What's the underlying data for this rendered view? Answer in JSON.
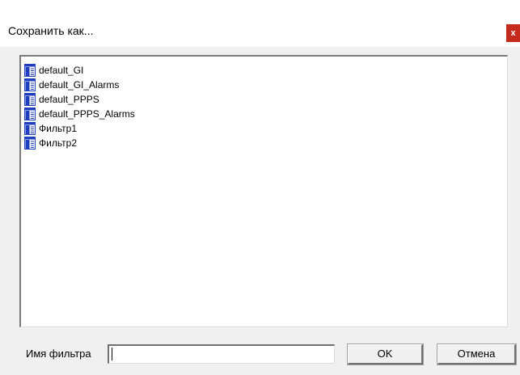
{
  "dialog": {
    "title": "Сохранить как...",
    "close_label": "x"
  },
  "files": [
    {
      "name": "default_GI",
      "icon": "filter-file-icon"
    },
    {
      "name": "default_GI_Alarms",
      "icon": "filter-file-icon"
    },
    {
      "name": "default_PPPS",
      "icon": "filter-file-icon"
    },
    {
      "name": "default_PPPS_Alarms",
      "icon": "filter-file-icon"
    },
    {
      "name": "Фильтр1",
      "icon": "filter-file-icon"
    },
    {
      "name": "Фильтр2",
      "icon": "filter-file-icon"
    }
  ],
  "footer": {
    "filter_name_label": "Имя фильтра",
    "filter_name_value": "",
    "ok_label": "OK",
    "cancel_label": "Отмена"
  },
  "colors": {
    "close_button": "#c42b1c",
    "icon_blue": "#1f3fbf"
  }
}
